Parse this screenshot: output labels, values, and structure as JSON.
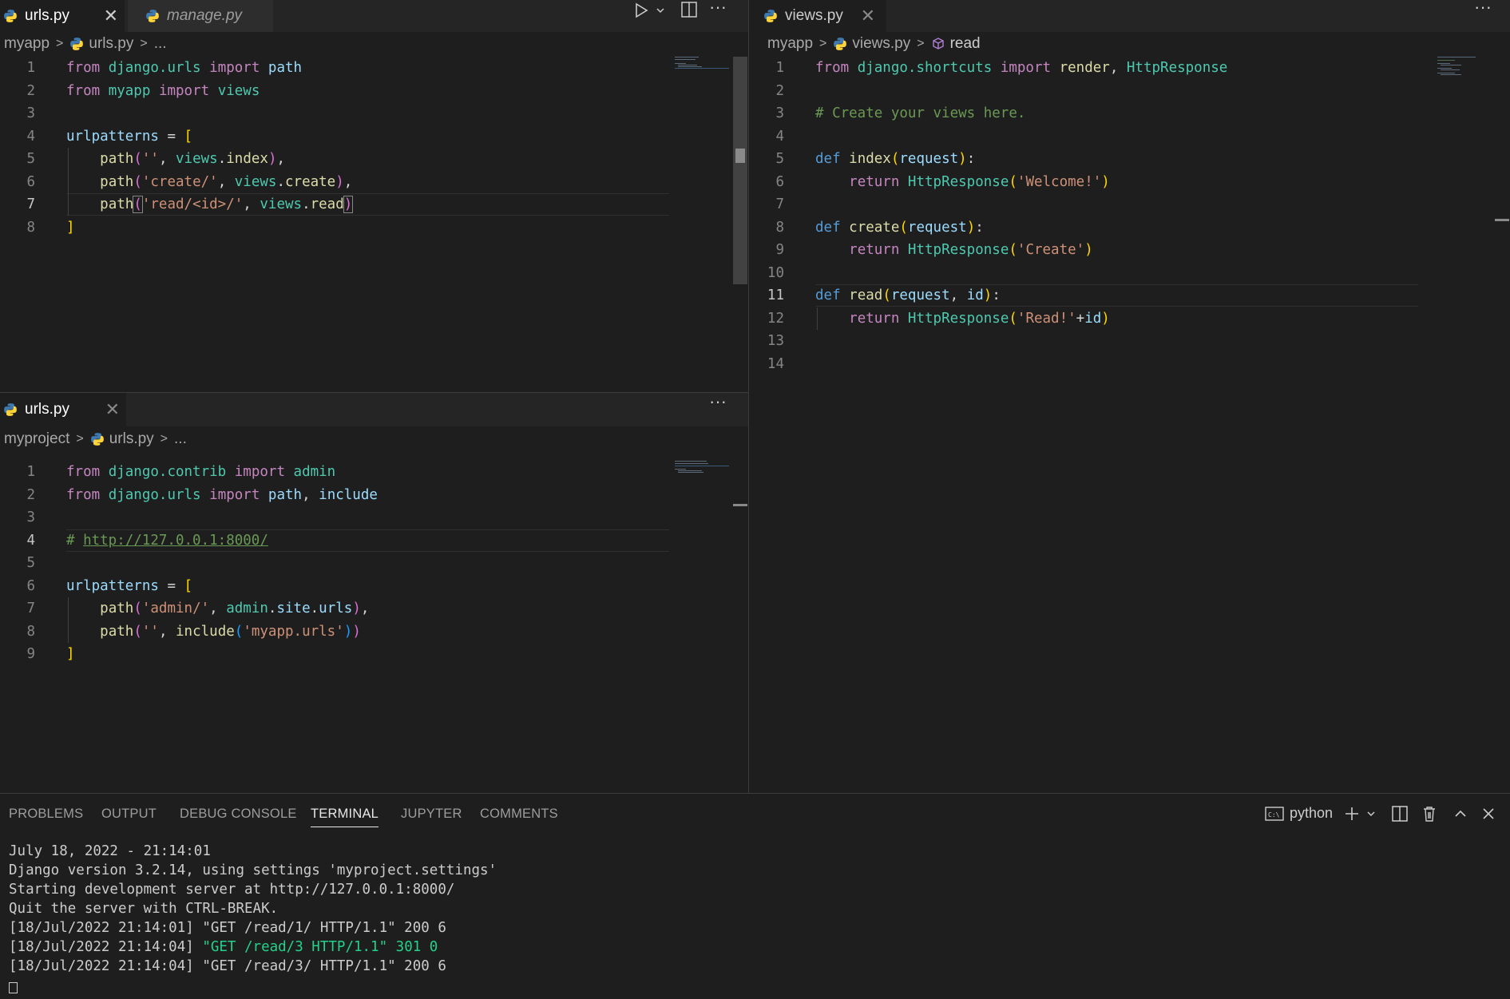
{
  "top_left": {
    "tabs": [
      {
        "label": "urls.py",
        "active": true,
        "preview": false
      },
      {
        "label": "manage.py",
        "active": false,
        "preview": true
      }
    ],
    "breadcrumb": [
      "myapp",
      "urls.py",
      "..."
    ],
    "line_numbers": [
      "1",
      "2",
      "3",
      "4",
      "5",
      "6",
      "7",
      "8"
    ],
    "current_line": "7"
  },
  "right": {
    "tabs": [
      {
        "label": "views.py",
        "active": true
      }
    ],
    "breadcrumb": [
      "myapp",
      "views.py",
      "read"
    ],
    "line_numbers": [
      "1",
      "2",
      "3",
      "4",
      "5",
      "6",
      "7",
      "8",
      "9",
      "10",
      "11",
      "12",
      "13",
      "14"
    ],
    "current_line": "11"
  },
  "bottom_left": {
    "tabs": [
      {
        "label": "urls.py",
        "active": true
      }
    ],
    "breadcrumb": [
      "myproject",
      "urls.py",
      "..."
    ],
    "line_numbers": [
      "1",
      "2",
      "3",
      "4",
      "5",
      "6",
      "7",
      "8",
      "9"
    ],
    "current_line": "4"
  },
  "panel": {
    "tabs": [
      "PROBLEMS",
      "OUTPUT",
      "DEBUG CONSOLE",
      "TERMINAL",
      "JUPYTER",
      "COMMENTS"
    ],
    "active_tab": "TERMINAL",
    "terminal_name": "python",
    "terminal_lines": [
      "July 18, 2022 - 21:14:01",
      "Django version 3.2.14, using settings 'myproject.settings'",
      "Starting development server at http://127.0.0.1:8000/",
      "Quit the server with CTRL-BREAK.",
      "[18/Jul/2022 21:14:01] \"GET /read/1/ HTTP/1.1\" 200 6",
      "[18/Jul/2022 21:14:04] ",
      "\"GET /read/3 HTTP/1.1\" 301 0",
      "[18/Jul/2022 21:14:04] \"GET /read/3/ HTTP/1.1\" 200 6"
    ]
  },
  "icons": {
    "run": "play-icon",
    "split": "split-editor-icon",
    "more": "more-actions-icon",
    "python_file": "python-file-icon",
    "symbol": "method-cube-icon"
  },
  "colors": {
    "background": "#1e1e1e",
    "tabbar": "#252526",
    "keyword": "#c586c0",
    "function": "#dcdcaa",
    "string": "#ce9178",
    "comment": "#6a9955",
    "variable": "#9cdcfe",
    "module": "#4ec9b0",
    "terminal_green": "#23d18b"
  }
}
